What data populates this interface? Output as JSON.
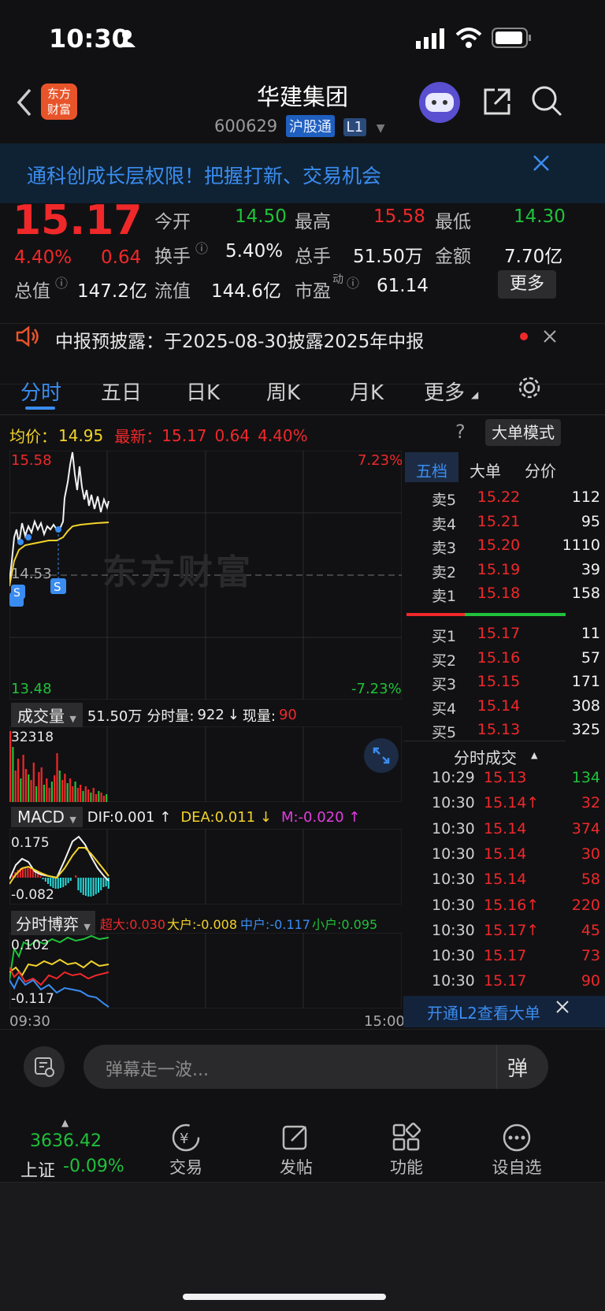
{
  "status_bar": {
    "time": "10:30"
  },
  "header": {
    "title": "华建集团",
    "code": "600629",
    "tag": "沪股通",
    "level": "L1",
    "logo_text": "东方财富"
  },
  "banner": {
    "text": "通科创成长层权限！把握打新、交易机会"
  },
  "quote": {
    "price": "15.17",
    "change_pct": "4.40%",
    "change_amt": "0.64",
    "open_label": "今开",
    "open": "14.50",
    "high_label": "最高",
    "high": "15.58",
    "low_label": "最低",
    "low": "14.30",
    "turnover_label": "换手",
    "turnover": "5.40%",
    "volume_label": "总手",
    "volume": "51.50万",
    "amount_label": "金额",
    "amount": "7.70亿",
    "mktcap_label": "总值",
    "mktcap": "147.2亿",
    "float_label": "流值",
    "float_cap": "144.6亿",
    "pe_label": "市盈",
    "pe_sup": "动",
    "pe": "61.14",
    "more_button": "更多"
  },
  "notice": {
    "text": "中报预披露：于2025-08-30披露2025年中报"
  },
  "tabs": [
    "分时",
    "五日",
    "日K",
    "周K",
    "月K",
    "更多"
  ],
  "chart_header": {
    "avg_label": "均价：",
    "avg": "14.95",
    "last_label": "最新：",
    "last": "15.17",
    "chg": "0.64",
    "pct": "4.40%",
    "big_order_button": "大单模式"
  },
  "price_axis": {
    "top": "15.58",
    "mid": "14.53",
    "bottom": "13.48",
    "top_pct": "7.23%",
    "bottom_pct": "-7.23%"
  },
  "watermark": "东方财富",
  "volume_panel": {
    "label": "成交量",
    "total": "51.50万",
    "tick_label": "分时量:",
    "tick": "922",
    "now_label": "现量:",
    "now": "90",
    "max": "32318"
  },
  "macd_panel": {
    "label": "MACD",
    "dif": "DIF:0.001 ↑",
    "dea": "DEA:0.011 ↓",
    "m": "M:-0.020 ↑",
    "top": "0.175",
    "bottom": "-0.082"
  },
  "game_panel": {
    "label": "分时博弈",
    "super": "超大:0.030",
    "big": "大户:-0.008",
    "mid": "中户:-0.117",
    "small": "小户:0.095",
    "top": "0.102",
    "bottom": "-0.117"
  },
  "time_axis": {
    "start": "09:30",
    "end": "15:00"
  },
  "orderbook": {
    "tabs": [
      "五档",
      "大单",
      "分价"
    ],
    "asks": [
      {
        "label": "卖5",
        "price": "15.22",
        "vol": "112"
      },
      {
        "label": "卖4",
        "price": "15.21",
        "vol": "95"
      },
      {
        "label": "卖3",
        "price": "15.20",
        "vol": "1110"
      },
      {
        "label": "卖2",
        "price": "15.19",
        "vol": "39"
      },
      {
        "label": "卖1",
        "price": "15.18",
        "vol": "158"
      }
    ],
    "bids": [
      {
        "label": "买1",
        "price": "15.17",
        "vol": "11"
      },
      {
        "label": "买2",
        "price": "15.16",
        "vol": "57"
      },
      {
        "label": "买3",
        "price": "15.15",
        "vol": "171"
      },
      {
        "label": "买4",
        "price": "15.14",
        "vol": "308"
      },
      {
        "label": "买5",
        "price": "15.13",
        "vol": "325"
      }
    ],
    "trades_title": "分时成交",
    "trades": [
      {
        "time": "10:29",
        "price": "15.13",
        "vol": "134",
        "dir": "down"
      },
      {
        "time": "10:30",
        "price": "15.14↑",
        "vol": "32",
        "dir": "up"
      },
      {
        "time": "10:30",
        "price": "15.14",
        "vol": "374",
        "dir": "up"
      },
      {
        "time": "10:30",
        "price": "15.14",
        "vol": "30",
        "dir": "up"
      },
      {
        "time": "10:30",
        "price": "15.14",
        "vol": "58",
        "dir": "up"
      },
      {
        "time": "10:30",
        "price": "15.16↑",
        "vol": "220",
        "dir": "up"
      },
      {
        "time": "10:30",
        "price": "15.17↑",
        "vol": "45",
        "dir": "up"
      },
      {
        "time": "10:30",
        "price": "15.17",
        "vol": "73",
        "dir": "up"
      },
      {
        "time": "10:30",
        "price": "15.17",
        "vol": "90",
        "dir": "up"
      }
    ],
    "l2_banner": "开通L2查看大单"
  },
  "comment": {
    "placeholder": "弹幕走一波..."
  },
  "bottom_nav": {
    "index_value": "3636.42",
    "index_name": "上证",
    "index_change": "-0.09%",
    "items": [
      "交易",
      "发帖",
      "功能",
      "设自选"
    ]
  },
  "colors": {
    "up": "#f0282a",
    "down": "#1fc23a",
    "accent": "#3a8cf0"
  }
}
